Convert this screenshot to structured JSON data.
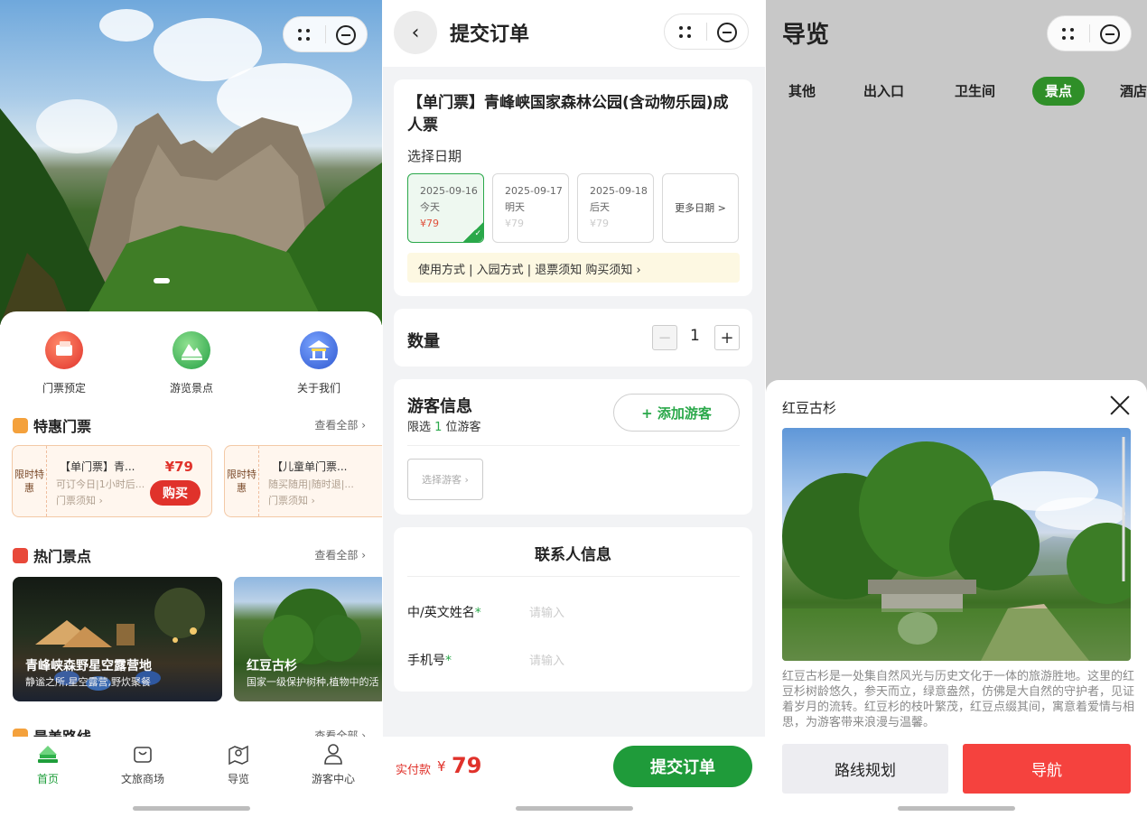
{
  "home": {
    "quick": [
      {
        "label": "门票预定",
        "icon": "ticket-icon",
        "color": "#e94b3c"
      },
      {
        "label": "游览景点",
        "icon": "mountain-icon",
        "color": "#3bb85a"
      },
      {
        "label": "关于我们",
        "icon": "pavilion-icon",
        "color": "#3a66d6"
      }
    ],
    "deals_section": {
      "title": "特惠门票",
      "see_all": "查看全部 ›"
    },
    "deals": [
      {
        "tag": "限时特惠",
        "name": "【单门票】青...",
        "sub": "可订今日|1小时后...",
        "note": "门票须知 ›",
        "price": "¥79",
        "buy": "购买"
      },
      {
        "tag": "限时特惠",
        "name": "【儿童单门票...",
        "sub": "随买随用|随时退|...",
        "note": "门票须知 ›",
        "price": "¥",
        "buy": "购"
      }
    ],
    "spots_section": {
      "title": "热门景点",
      "see_all": "查看全部 ›"
    },
    "spots": [
      {
        "name": "青峰峡森野星空露营地",
        "desc": "静谧之所,星空露营,野炊聚餐"
      },
      {
        "name": "红豆古杉",
        "desc": "国家一级保护树种,植物中的活"
      }
    ],
    "routes_section": {
      "title": "最美路线",
      "see_all": "查看全部 ›"
    },
    "tabs": [
      {
        "label": "首页",
        "icon": "home-icon",
        "active": true
      },
      {
        "label": "文旅商场",
        "icon": "shopping-bag-icon",
        "active": false
      },
      {
        "label": "导览",
        "icon": "map-pin-icon",
        "active": false
      },
      {
        "label": "游客中心",
        "icon": "user-icon",
        "active": false
      }
    ]
  },
  "order": {
    "title": "提交订单",
    "ticket_title": "【单门票】青峰峡国家森林公园(含动物乐园)成人票",
    "date_label": "选择日期",
    "dates": [
      {
        "date": "2025-09-16",
        "day": "今天",
        "price": "¥79",
        "selected": true
      },
      {
        "date": "2025-09-17",
        "day": "明天",
        "price": "¥79",
        "selected": false
      },
      {
        "date": "2025-09-18",
        "day": "后天",
        "price": "¥79",
        "selected": false
      }
    ],
    "more_dates": "更多日期 >",
    "rules": "使用方式 | 入园方式 | 退票须知 购买须知 ›",
    "quantity_label": "数量",
    "quantity": "1",
    "minus": "−",
    "plus": "+",
    "visitor_title": "游客信息",
    "visitor_sub_prefix": "限选 ",
    "visitor_sub_count": "1",
    "visitor_sub_suffix": " 位游客",
    "add_visitor": "+ 添加游客",
    "select_visitor": "选择游客 ›",
    "contact_title": "联系人信息",
    "name_label": "中/英文姓名",
    "phone_label": "手机号",
    "required_mark": "*",
    "name_placeholder": "请输入",
    "phone_placeholder": "请输入",
    "pay_label": "实付款",
    "pay_currency": "¥",
    "pay_amount": "79",
    "submit": "提交订单"
  },
  "guide": {
    "title": "导览",
    "categories": [
      {
        "label": "其他",
        "active": false
      },
      {
        "label": "出入口",
        "active": false
      },
      {
        "label": "卫生间",
        "active": false
      },
      {
        "label": "景点",
        "active": true
      },
      {
        "label": "酒店",
        "active": false
      }
    ],
    "panel_title": "红豆古杉",
    "panel_desc": "红豆古杉是一处集自然风光与历史文化于一体的旅游胜地。这里的红豆杉树龄悠久，参天而立，绿意盎然，仿佛是大自然的守护者，见证着岁月的流转。红豆杉的枝叶繁茂，红豆点缀其间，寓意着爱情与相思，为游客带来浪漫与温馨。",
    "route_btn": "路线规划",
    "nav_btn": "导航"
  },
  "colors": {
    "accent_green": "#1f9b3a",
    "price_red": "#e0322b",
    "nav_red": "#f5423e"
  }
}
